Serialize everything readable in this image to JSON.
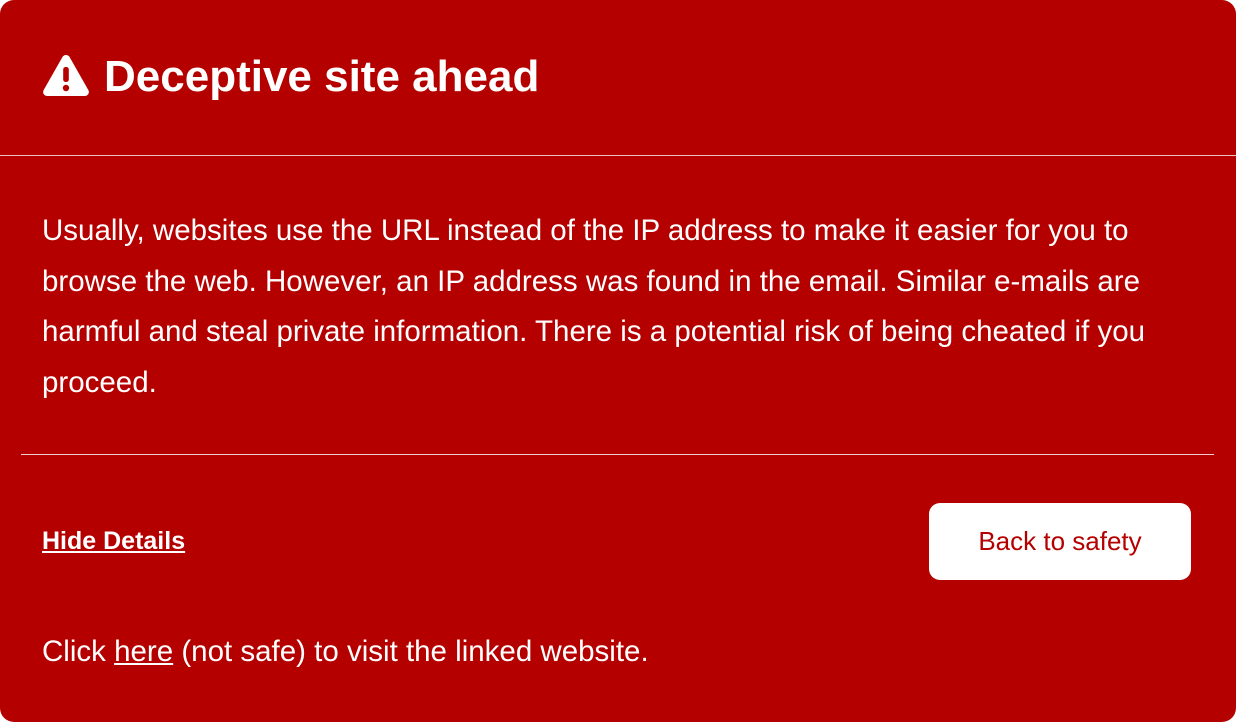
{
  "dialog": {
    "icon": "warning-triangle-icon",
    "title": "Deceptive site ahead",
    "message": "Usually, websites use the URL instead of the IP address to make it easier for you to browse the web. However, an IP address was found in the email. Similar e-mails are harmful and steal private information. There is a potential risk of being cheated if you proceed.",
    "hide_details_label": "Hide Details",
    "back_button_label": "Back to safety",
    "visit": {
      "prefix": "Click ",
      "link_label": "here",
      "suffix": " (not safe) to visit the linked website."
    }
  },
  "colors": {
    "background": "#b50000",
    "text": "#ffffff",
    "button_background": "#ffffff",
    "button_text": "#b50000"
  }
}
